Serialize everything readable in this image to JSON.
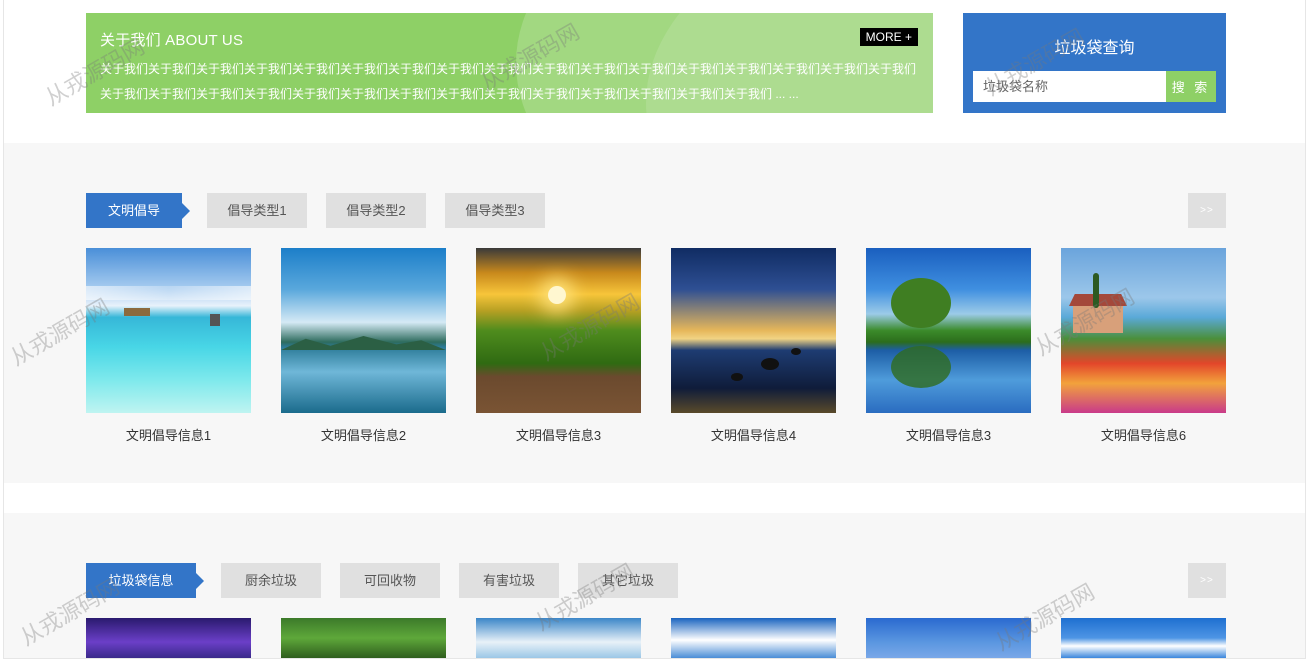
{
  "about": {
    "title": "关于我们 ABOUT US",
    "more": "MORE +",
    "text": "关于我们关于我们关于我们关于我们关于我们关于我们关于我们关于我们关于我们关于我们关于我们关于我们关于我们关于我们关于我们关于我们关于我们关于我们关于我们关于我们关于我们关于我们关于我们关于我们关于我们关于我们关于我们关于我们关于我们关于我们关于我们 ... ..."
  },
  "search": {
    "title": "垃圾袋查询",
    "placeholder": "垃圾袋名称",
    "button": "搜 索"
  },
  "section1": {
    "tabs": [
      "文明倡导",
      "倡导类型1",
      "倡导类型2",
      "倡导类型3"
    ],
    "more": ">>",
    "items": [
      {
        "caption": "文明倡导信息1",
        "image": "tropical-lagoon-image"
      },
      {
        "caption": "文明倡导信息2",
        "image": "lake-mountains-image"
      },
      {
        "caption": "文明倡导信息3",
        "image": "sunset-forest-deck-image"
      },
      {
        "caption": "文明倡导信息4",
        "image": "dusk-shore-rocks-image"
      },
      {
        "caption": "文明倡导信息3",
        "image": "tree-reflection-lake-image"
      },
      {
        "caption": "文明倡导信息6",
        "image": "painted-seaside-cottage-image"
      }
    ]
  },
  "section2": {
    "tabs": [
      "垃圾袋信息",
      "厨余垃圾",
      "可回收物",
      "有害垃圾",
      "其它垃圾"
    ],
    "more": ">>",
    "items": [
      {
        "image": "purple-sky-image"
      },
      {
        "image": "green-trees-image"
      },
      {
        "image": "clouds-sky-image"
      },
      {
        "image": "blue-sky-clouds-image"
      },
      {
        "image": "blue-sky-image"
      },
      {
        "image": "blue-sky-cloud-image"
      }
    ]
  },
  "watermark": "从戎源码网",
  "colors": {
    "green": "#8ed066",
    "blue": "#3375c8",
    "tab_gray": "#e0e0e0",
    "section_bg": "#f7f7f7"
  }
}
